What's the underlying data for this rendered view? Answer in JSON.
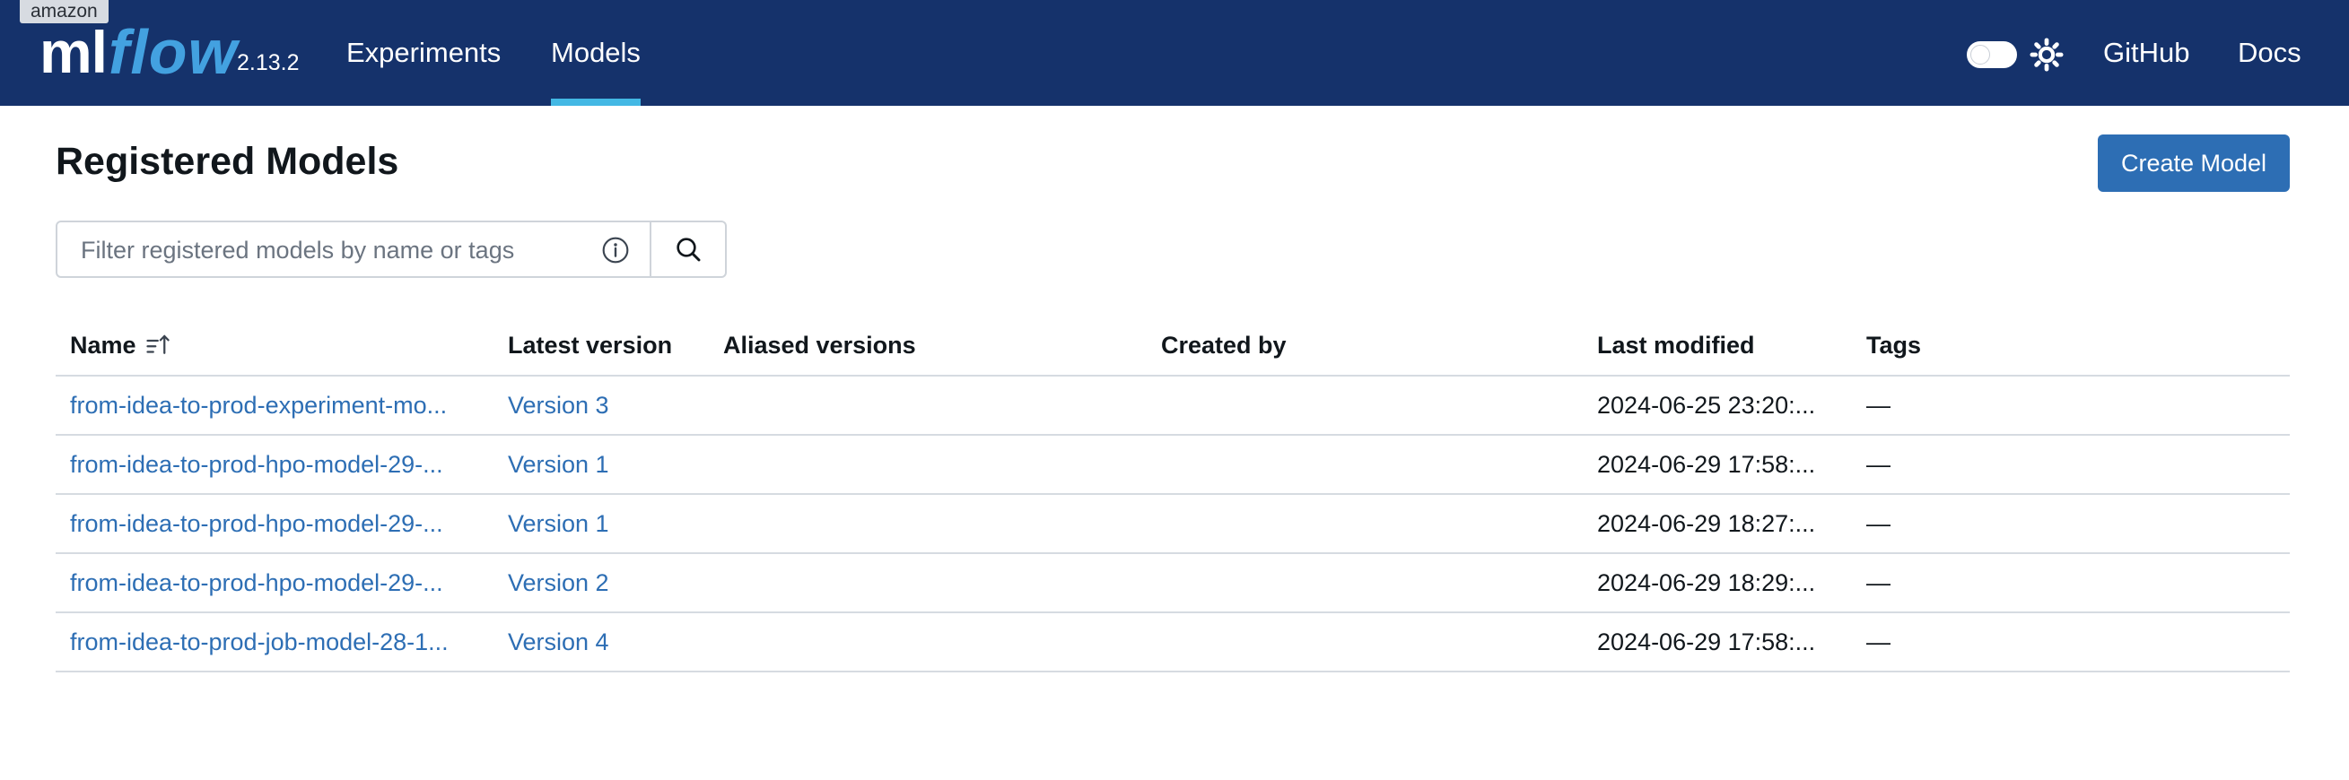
{
  "header": {
    "env_badge": "amazon",
    "logo_ml": "ml",
    "logo_flow": "flow",
    "version": "2.13.2",
    "nav": {
      "experiments": "Experiments",
      "models": "Models"
    },
    "github": "GitHub",
    "docs": "Docs",
    "icons": {
      "theme_toggle": "toggle-switch",
      "theme": "sun-icon"
    }
  },
  "page": {
    "title": "Registered Models",
    "create_button": "Create Model"
  },
  "search": {
    "placeholder": "Filter registered models by name or tags",
    "value": ""
  },
  "table": {
    "columns": {
      "name": "Name",
      "latest_version": "Latest version",
      "aliased_versions": "Aliased versions",
      "created_by": "Created by",
      "last_modified": "Last modified",
      "tags": "Tags"
    },
    "rows": [
      {
        "name": "from-idea-to-prod-experiment-mo...",
        "latest_version": "Version 3",
        "aliased_versions": "",
        "created_by": "",
        "last_modified": "2024-06-25 23:20:...",
        "tags": "—"
      },
      {
        "name": "from-idea-to-prod-hpo-model-29-...",
        "latest_version": "Version 1",
        "aliased_versions": "",
        "created_by": "",
        "last_modified": "2024-06-29 17:58:...",
        "tags": "—"
      },
      {
        "name": "from-idea-to-prod-hpo-model-29-...",
        "latest_version": "Version 1",
        "aliased_versions": "",
        "created_by": "",
        "last_modified": "2024-06-29 18:27:...",
        "tags": "—"
      },
      {
        "name": "from-idea-to-prod-hpo-model-29-...",
        "latest_version": "Version 2",
        "aliased_versions": "",
        "created_by": "",
        "last_modified": "2024-06-29 18:29:...",
        "tags": "—"
      },
      {
        "name": "from-idea-to-prod-job-model-28-1...",
        "latest_version": "Version 4",
        "aliased_versions": "",
        "created_by": "",
        "last_modified": "2024-06-29 17:58:...",
        "tags": "—"
      }
    ]
  },
  "colors": {
    "header_bg": "#15326b",
    "accent": "#43b8e4",
    "link": "#2d6eb4",
    "primary_button": "#2d6eb4"
  }
}
